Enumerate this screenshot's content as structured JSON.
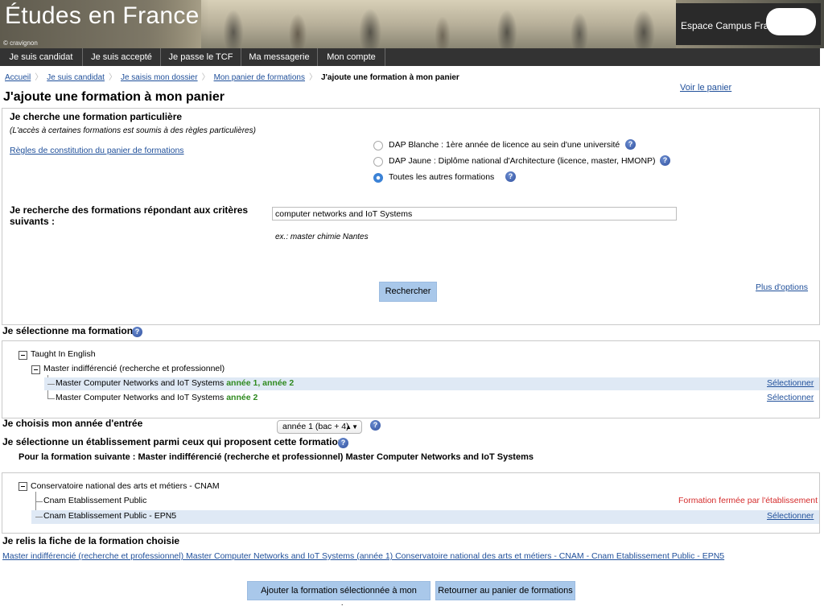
{
  "header": {
    "site_title": "Études en France",
    "photo_credit": "© cravignon",
    "campus_label": "Espace Campus France"
  },
  "nav": {
    "items": [
      {
        "label": "Je suis candidat"
      },
      {
        "label": "Je suis accepté"
      },
      {
        "label": "Je passe le TCF"
      },
      {
        "label": "Ma messagerie"
      },
      {
        "label": "Mon compte"
      }
    ]
  },
  "breadcrumb": {
    "items": [
      "Accueil",
      "Je suis candidat",
      "Je saisis mon dossier",
      "Mon panier de formations"
    ],
    "current": "J'ajoute une formation à mon panier"
  },
  "page": {
    "view_basket": "Voir le panier",
    "title": "J'ajoute une formation à mon panier"
  },
  "search_panel": {
    "title": "Je cherche une formation particulière",
    "note": "(L'accès à certaines formations est soumis à des règles particulières)",
    "rules_link": "Règles de constitution du panier de formations",
    "options": [
      {
        "label": "DAP Blanche : 1ère année de licence au sein d'une université",
        "checked": false
      },
      {
        "label": "DAP Jaune : Diplôme national d'Architecture (licence, master, HMONP)",
        "checked": false
      },
      {
        "label": "Toutes les autres formations",
        "checked": true
      }
    ],
    "criteria_label": "Je recherche des formations répondant aux critères suivants :",
    "query_value": "computer networks and IoT Systems",
    "example": "ex.: master chimie Nantes",
    "search_button": "Rechercher",
    "more_options": "Plus d'options"
  },
  "select_formation": {
    "title": "Je sélectionne ma formation",
    "root": "Taught In English",
    "group": "Master indifférencié (recherche et professionnel)",
    "rows": [
      {
        "name": "Master Computer Networks and IoT Systems",
        "years": "année 1, année 2",
        "action": "Sélectionner"
      },
      {
        "name": "Master Computer Networks and IoT Systems",
        "years": "année 2",
        "action": "Sélectionner"
      }
    ]
  },
  "entry_year": {
    "label": "Je choisis mon année d'entrée",
    "selected": "année 1 (bac + 4)"
  },
  "establishment": {
    "title": "Je sélectionne un établissement parmi ceux qui proposent cette formation",
    "subtitle": "Pour la formation suivante : Master indifférencié (recherche et professionnel) Master Computer Networks and IoT Systems",
    "root": "Conservatoire national des arts et métiers - CNAM",
    "rows": [
      {
        "name": "Cnam Etablissement Public",
        "status": "Formation fermée par l'établissement"
      },
      {
        "name": "Cnam Etablissement Public - EPN5",
        "action": "Sélectionner"
      }
    ]
  },
  "reread": {
    "title": "Je relis la fiche de la formation choisie",
    "link": "Master indifférencié (recherche et professionnel) Master Computer Networks and IoT Systems (année 1) Conservatoire national des arts et métiers - CNAM - Cnam Etablissement Public - EPN5"
  },
  "footer_buttons": {
    "add": "Ajouter la formation sélectionnée à mon panier",
    "back": "Retourner au panier de formations"
  },
  "colors": {
    "nav_bg": "#333333",
    "link": "#1f4f9a",
    "button_bg": "#a9c8ea",
    "highlight_row": "#dfe9f5",
    "green_years": "#2f8a1f",
    "closed_red": "#d42b2b"
  }
}
